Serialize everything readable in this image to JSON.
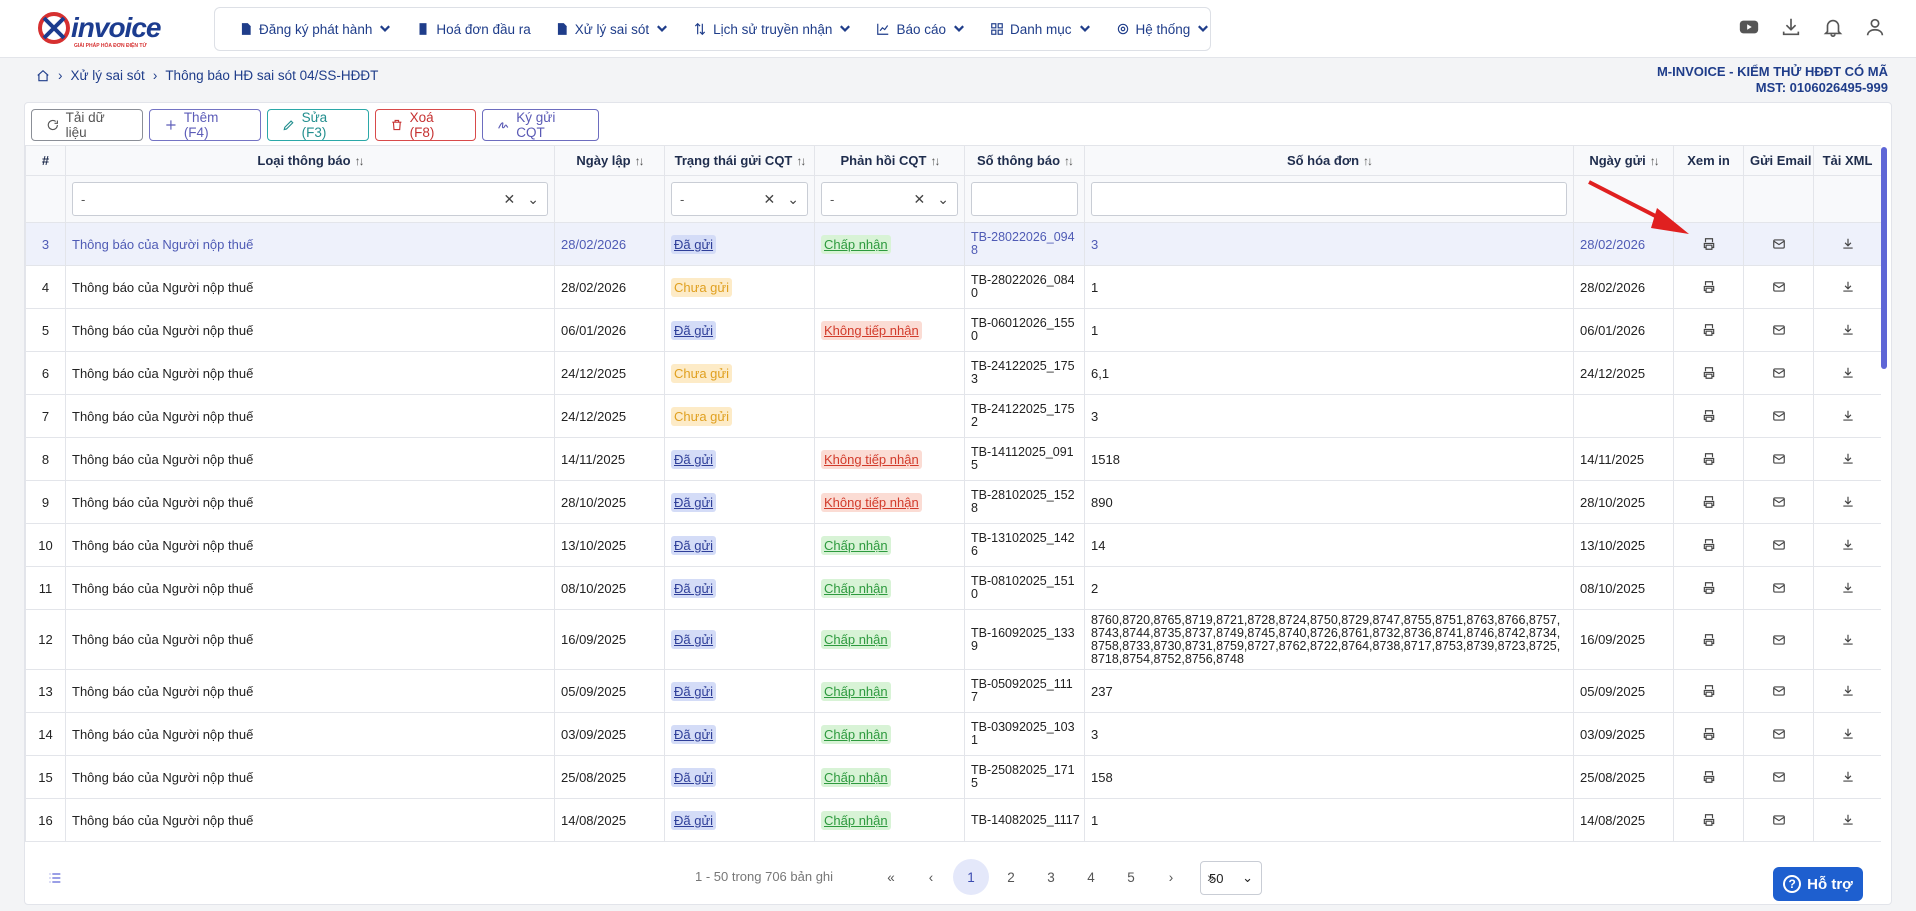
{
  "brand": {
    "name": "invoice",
    "tagline": "GIẢI PHÁP HÓA ĐƠN ĐIỆN TỬ"
  },
  "nav": [
    {
      "label": "Đăng ký phát hành",
      "icon": "document-icon",
      "dropdown": true
    },
    {
      "label": "Hoá đơn đầu ra",
      "icon": "invoice-icon",
      "dropdown": false
    },
    {
      "label": "Xử lý sai sót",
      "icon": "document-edit-icon",
      "dropdown": true
    },
    {
      "label": "Lịch sử truyền nhận",
      "icon": "transfer-icon",
      "dropdown": true
    },
    {
      "label": "Báo cáo",
      "icon": "chart-icon",
      "dropdown": true
    },
    {
      "label": "Danh mục",
      "icon": "grid-icon",
      "dropdown": true
    },
    {
      "label": "Hệ thống",
      "icon": "gear-icon",
      "dropdown": true
    }
  ],
  "breadcrumb": {
    "level1": "Xử lý sai sót",
    "level2": "Thông báo HĐ sai sót 04/SS-HĐĐT"
  },
  "company": {
    "name": "M-INVOICE - KIỂM THỬ HĐĐT CÓ MÃ",
    "tax": "MST: 0106026495-999"
  },
  "toolbar": {
    "reload": "Tải dữ liệu",
    "add": "Thêm (F4)",
    "edit": "Sửa (F3)",
    "delete": "Xoá (F8)",
    "sign": "Ký gửi CQT"
  },
  "columns": {
    "index": "#",
    "type": "Loại thông báo",
    "date": "Ngày lập",
    "status": "Trạng thái gửi CQT",
    "response": "Phản hồi CQT",
    "number": "Số thông báo",
    "invoices": "Số hóa đơn",
    "sent_date": "Ngày gửi",
    "print": "Xem in",
    "email": "Gửi Email",
    "xml": "Tải XML"
  },
  "filters": {
    "type": "-",
    "status": "-",
    "response": "-"
  },
  "rows": [
    {
      "idx": "3",
      "type": "Thông báo của Người nộp thuế",
      "date": "28/02/2026",
      "status": "Đã gửi",
      "status_kind": "sent",
      "resp": "Chấp nhận",
      "resp_kind": "ok",
      "num": "TB-28022026_0948",
      "inv": "3",
      "sent": "28/02/2026",
      "selected": true
    },
    {
      "idx": "4",
      "type": "Thông báo của Người nộp thuế",
      "date": "28/02/2026",
      "status": "Chưa gửi",
      "status_kind": "wait",
      "resp": "",
      "resp_kind": "",
      "num": "TB-28022026_0840",
      "inv": "1",
      "sent": "28/02/2026"
    },
    {
      "idx": "5",
      "type": "Thông báo của Người nộp thuế",
      "date": "06/01/2026",
      "status": "Đã gửi",
      "status_kind": "sent",
      "resp": "Không tiếp nhận",
      "resp_kind": "no",
      "num": "TB-06012026_1550",
      "inv": "1",
      "sent": "06/01/2026"
    },
    {
      "idx": "6",
      "type": "Thông báo của Người nộp thuế",
      "date": "24/12/2025",
      "status": "Chưa gửi",
      "status_kind": "wait",
      "resp": "",
      "resp_kind": "",
      "num": "TB-24122025_1753",
      "inv": "6,1",
      "sent": "24/12/2025"
    },
    {
      "idx": "7",
      "type": "Thông báo của Người nộp thuế",
      "date": "24/12/2025",
      "status": "Chưa gửi",
      "status_kind": "wait",
      "resp": "",
      "resp_kind": "",
      "num": "TB-24122025_1752",
      "inv": "3",
      "sent": ""
    },
    {
      "idx": "8",
      "type": "Thông báo của Người nộp thuế",
      "date": "14/11/2025",
      "status": "Đã gửi",
      "status_kind": "sent",
      "resp": "Không tiếp nhận",
      "resp_kind": "no",
      "num": "TB-14112025_0915",
      "inv": "1518",
      "sent": "14/11/2025"
    },
    {
      "idx": "9",
      "type": "Thông báo của Người nộp thuế",
      "date": "28/10/2025",
      "status": "Đã gửi",
      "status_kind": "sent",
      "resp": "Không tiếp nhận",
      "resp_kind": "no",
      "num": "TB-28102025_1528",
      "inv": "890",
      "sent": "28/10/2025"
    },
    {
      "idx": "10",
      "type": "Thông báo của Người nộp thuế",
      "date": "13/10/2025",
      "status": "Đã gửi",
      "status_kind": "sent",
      "resp": "Chấp nhận",
      "resp_kind": "ok",
      "num": "TB-13102025_1426",
      "inv": "14",
      "sent": "13/10/2025"
    },
    {
      "idx": "11",
      "type": "Thông báo của Người nộp thuế",
      "date": "08/10/2025",
      "status": "Đã gửi",
      "status_kind": "sent",
      "resp": "Chấp nhận",
      "resp_kind": "ok",
      "num": "TB-08102025_1510",
      "inv": "2",
      "sent": "08/10/2025"
    },
    {
      "idx": "12",
      "type": "Thông báo của Người nộp thuế",
      "date": "16/09/2025",
      "status": "Đã gửi",
      "status_kind": "sent",
      "resp": "Chấp nhận",
      "resp_kind": "ok",
      "num": "TB-16092025_1339",
      "inv": "8760,8720,8765,8719,8721,8728,8724,8750,8729,8747,8755,8751,8763,8766,8757,8743,8744,8735,8737,8749,8745,8740,8726,8761,8732,8736,8741,8746,8742,8734,8758,8733,8730,8731,8759,8727,8762,8722,8764,8738,8717,8753,8739,8723,8725,8718,8754,8752,8756,8748",
      "sent": "16/09/2025",
      "tall": true
    },
    {
      "idx": "13",
      "type": "Thông báo của Người nộp thuế",
      "date": "05/09/2025",
      "status": "Đã gửi",
      "status_kind": "sent",
      "resp": "Chấp nhận",
      "resp_kind": "ok",
      "num": "TB-05092025_1117",
      "inv": "237",
      "sent": "05/09/2025"
    },
    {
      "idx": "14",
      "type": "Thông báo của Người nộp thuế",
      "date": "03/09/2025",
      "status": "Đã gửi",
      "status_kind": "sent",
      "resp": "Chấp nhận",
      "resp_kind": "ok",
      "num": "TB-03092025_1031",
      "inv": "3",
      "sent": "03/09/2025"
    },
    {
      "idx": "15",
      "type": "Thông báo của Người nộp thuế",
      "date": "25/08/2025",
      "status": "Đã gửi",
      "status_kind": "sent",
      "resp": "Chấp nhận",
      "resp_kind": "ok",
      "num": "TB-25082025_1715",
      "inv": "158",
      "sent": "25/08/2025"
    },
    {
      "idx": "16",
      "type": "Thông báo của Người nộp thuế",
      "date": "14/08/2025",
      "status": "Đã gửi",
      "status_kind": "sent",
      "resp": "Chấp nhận",
      "resp_kind": "ok",
      "num": "TB-14082025_1117",
      "inv": "1",
      "sent": "14/08/2025",
      "oneline": true
    }
  ],
  "pagination": {
    "info": "1 - 50 trong 706 bản ghi",
    "pages": [
      "1",
      "2",
      "3",
      "4",
      "5"
    ],
    "current": "1",
    "page_size": "50"
  },
  "help": {
    "label": "Hỗ trợ"
  },
  "colors": {
    "primary": "#1f3d8a",
    "accent": "#5e66d6",
    "help": "#1e5fcf",
    "annotation_arrow": "#e02020"
  }
}
